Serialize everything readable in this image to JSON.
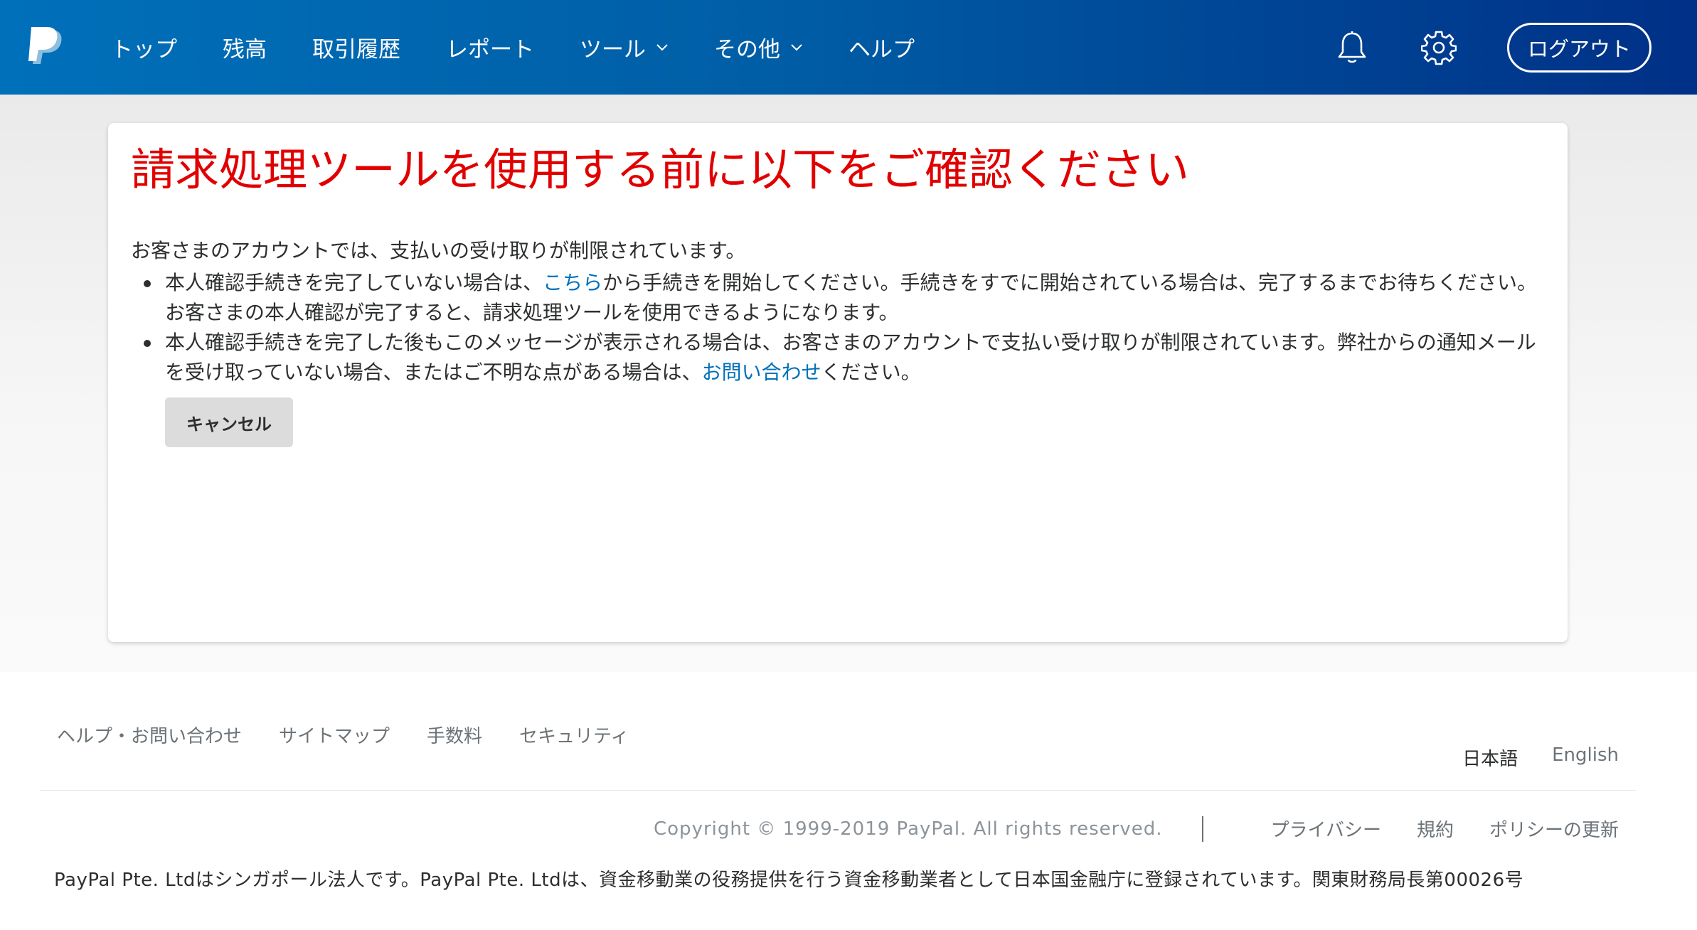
{
  "header": {
    "logo": "paypal-logo",
    "nav": [
      {
        "label": "トップ",
        "dropdown": false
      },
      {
        "label": "残高",
        "dropdown": false
      },
      {
        "label": "取引履歴",
        "dropdown": false
      },
      {
        "label": "レポート",
        "dropdown": false
      },
      {
        "label": "ツール",
        "dropdown": true
      },
      {
        "label": "その他",
        "dropdown": true
      },
      {
        "label": "ヘルプ",
        "dropdown": false
      }
    ],
    "notification_icon": "bell-icon",
    "settings_icon": "gear-icon",
    "logout_label": "ログアウト"
  },
  "card": {
    "title": "請求処理ツールを使用する前に以下をご確認ください",
    "intro": "お客さまのアカウントでは、支払いの受け取りが制限されています。",
    "bullet1": {
      "pre": "本人確認手続きを完了していない場合は、",
      "link": "こちら",
      "post": "から手続きを開始してください。手続きをすでに開始されている場合は、完了するまでお待ちください。お客さまの本人確認が完了すると、請求処理ツールを使用できるようになります。"
    },
    "bullet2": {
      "pre": "本人確認手続きを完了した後もこのメッセージが表示される場合は、お客さまのアカウントで支払い受け取りが制限されています。弊社からの通知メールを受け取っていない場合、またはご不明な点がある場合は、",
      "link": "お問い合わせ",
      "post": "ください。"
    },
    "cancel_label": "キャンセル"
  },
  "footer": {
    "links": [
      "ヘルプ・お問い合わせ",
      "サイトマップ",
      "手数料",
      "セキュリティ"
    ],
    "languages": {
      "active": "日本語",
      "other": "English"
    },
    "copyright": "Copyright © 1999-2019 PayPal. All rights reserved.",
    "legal_links": [
      "プライバシー",
      "規約",
      "ポリシーの更新"
    ],
    "company_notice": "PayPal Pte. Ltdはシンガポール法人です。PayPal Pte. Ltdは、資金移動業の役務提供を行う資金移動業者として日本国金融庁に登録されています。関東財務局長第00026号"
  },
  "colors": {
    "header_start": "#0070ba",
    "header_end": "#003087",
    "title_red": "#e10000",
    "link_blue": "#0070ba"
  }
}
